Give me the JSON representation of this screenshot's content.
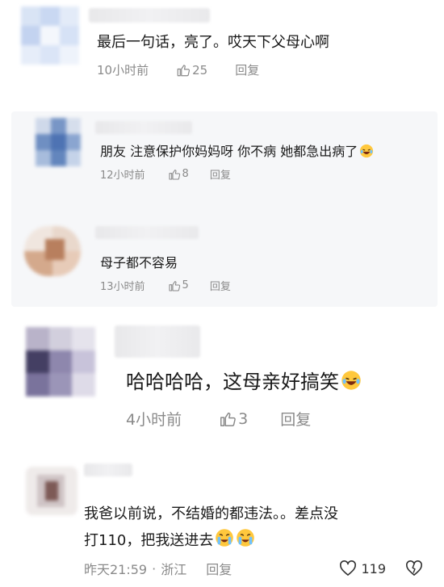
{
  "comments": [
    {
      "text": "最后一句话，亮了。哎天下父母心啊",
      "time": "10小时前",
      "likes": "25",
      "reply_label": "回复",
      "like_icon": "thumb-up-icon"
    },
    {
      "text": "朋友 注意保护你妈妈呀 你不病 她都急出病了",
      "time": "12小时前",
      "likes": "8",
      "reply_label": "回复",
      "emoji": "laughing-tears-emoji"
    },
    {
      "text": "母子都不容易",
      "time": "13小时前",
      "likes": "5",
      "reply_label": "回复"
    },
    {
      "text": "哈哈哈哈，这母亲好搞笑",
      "time": "4小时前",
      "likes": "3",
      "reply_label": "回复",
      "emoji": "laughing-tears-emoji"
    },
    {
      "text_line1": "我爸以前说，不结婚的都违法。。差点没",
      "text_line2": "打110，把我送进去",
      "time": "昨天21:59",
      "separator": "·",
      "location": "浙江",
      "reply_label": "回复",
      "likes": "119",
      "emoji": "crying-face-emoji"
    }
  ],
  "colors": {
    "text": "#1a1a1a",
    "meta": "#8a8a8a",
    "reply_panel_bg": "#f6f7f9",
    "emoji_face": "#ffc83d"
  }
}
